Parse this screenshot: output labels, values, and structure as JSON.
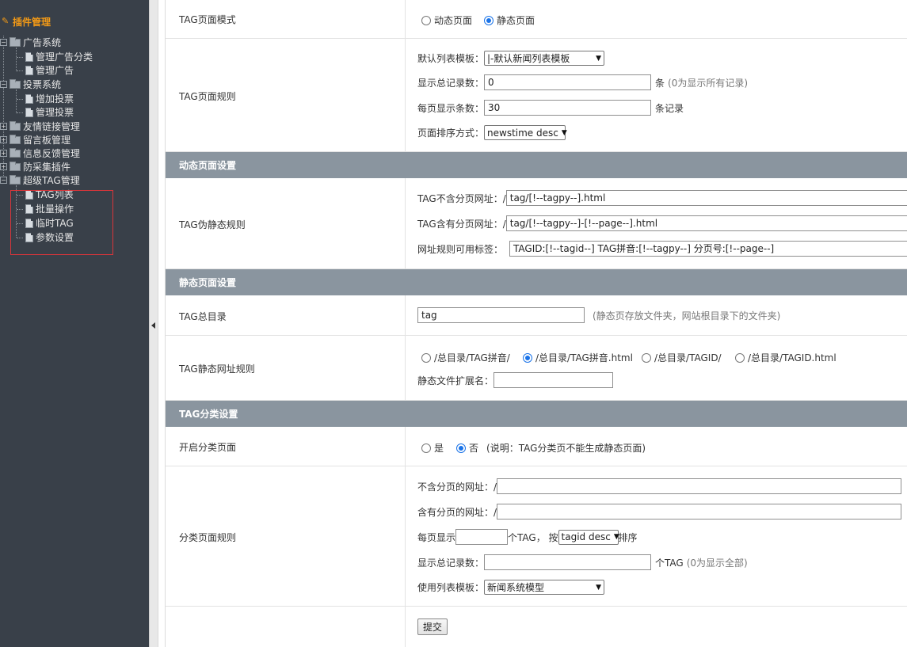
{
  "sidebar": {
    "title": "插件管理",
    "items": [
      {
        "label": "广告系统"
      },
      {
        "label": "管理广告分类"
      },
      {
        "label": "管理广告"
      },
      {
        "label": "投票系统"
      },
      {
        "label": "增加投票"
      },
      {
        "label": "管理投票"
      },
      {
        "label": "友情链接管理"
      },
      {
        "label": "留言板管理"
      },
      {
        "label": "信息反馈管理"
      },
      {
        "label": "防采集插件"
      },
      {
        "label": "超级TAG管理"
      },
      {
        "label": "TAG列表"
      },
      {
        "label": "批量操作"
      },
      {
        "label": "临时TAG"
      },
      {
        "label": "参数设置"
      }
    ]
  },
  "form": {
    "tag_mode": {
      "label": "TAG页面模式",
      "options": [
        "动态页面",
        "静态页面"
      ],
      "selected": "静态页面"
    },
    "tag_rules": {
      "label": "TAG页面规则",
      "list_template_label": "默认列表模板：",
      "list_template_value": "|-默认新闻列表模板",
      "total_label": "显示总记录数：",
      "total_value": "0",
      "total_unit": "条",
      "total_hint": "(0为显示所有记录)",
      "per_page_label": "每页显示条数：",
      "per_page_value": "30",
      "per_page_unit": "条记录",
      "sort_label": "页面排序方式：",
      "sort_value": "newstime desc"
    },
    "dynamic_section": "动态页面设置",
    "pseudo": {
      "label": "TAG伪静态规则",
      "no_page_label": "TAG不含分页网址：/",
      "no_page_value": "tag/[!--tagpy--].html",
      "page_label": "TAG含有分页网址：/",
      "page_value": "tag/[!--tagpy--]-[!--page--].html",
      "tags_label": "网址规则可用标签：",
      "tags_value": "TAGID:[!--tagid--]  TAG拼音:[!--tagpy--]  分页号:[!--page--]"
    },
    "static_section": "静态页面设置",
    "tag_dir": {
      "label": "TAG总目录",
      "value": "tag",
      "hint": "(静态页存放文件夹，网站根目录下的文件夹)"
    },
    "static_rule": {
      "label": "TAG静态网址规则",
      "options": [
        "/总目录/TAG拼音/",
        "/总目录/TAG拼音.html",
        "/总目录/TAGID/",
        "/总目录/TAGID.html"
      ],
      "selected": "/总目录/TAG拼音.html",
      "ext_label": "静态文件扩展名：",
      "ext_value": ""
    },
    "category_section": "TAG分类设置",
    "category_open": {
      "label": "开启分类页面",
      "options": [
        "是",
        "否"
      ],
      "selected": "否",
      "hint": "(说明：TAG分类页不能生成静态页面)"
    },
    "category_rules": {
      "label": "分类页面规则",
      "no_page_label": "不含分页的网址：/",
      "no_page_value": "",
      "page_label": "含有分页的网址：/",
      "page_value": "",
      "per_page_label": "每页显示",
      "per_page_value": "",
      "per_page_unit": "个TAG，  按",
      "sort_value": "tagid desc",
      "sort_suffix": "排序",
      "total_label": "显示总记录数：",
      "total_value": "",
      "total_unit": "个TAG",
      "total_hint": "(0为显示全部)",
      "template_label": "使用列表模板：",
      "template_value": "新闻系统模型"
    },
    "submit_label": "提交"
  },
  "colors": {
    "sidebar_bg": "#394049",
    "sidebar_title": "#f39a16",
    "section_bg": "#8a959f",
    "radio_selected": "#1a73e8",
    "highlight_box": "#d9353a"
  }
}
